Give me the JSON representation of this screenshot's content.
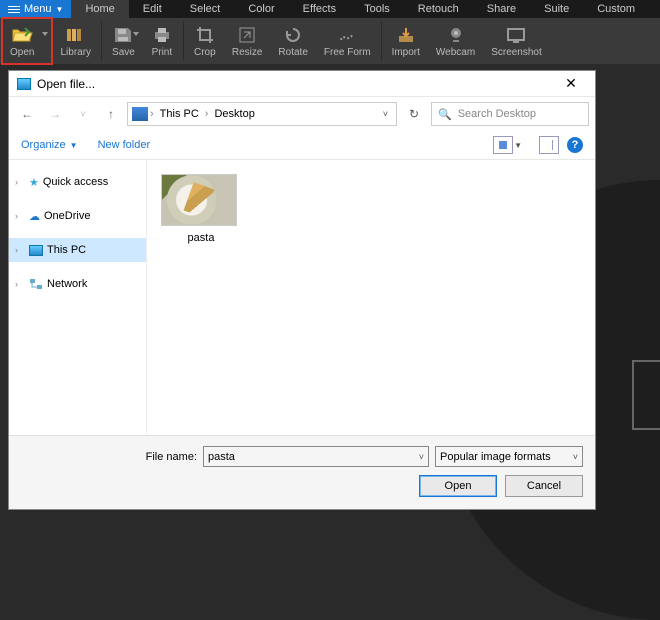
{
  "menu": {
    "label": "Menu"
  },
  "tabs": [
    "Home",
    "Edit",
    "Select",
    "Color",
    "Effects",
    "Tools",
    "Retouch",
    "Share",
    "Suite",
    "Custom"
  ],
  "active_tab_index": 0,
  "ribbon": [
    {
      "label": "Open",
      "highlight": true,
      "dropdown": true
    },
    {
      "label": "Library"
    },
    {
      "label": "Save",
      "dropdown": true
    },
    {
      "label": "Print"
    },
    {
      "label": "Crop"
    },
    {
      "label": "Resize"
    },
    {
      "label": "Rotate"
    },
    {
      "label": "Free Form"
    },
    {
      "label": "Import"
    },
    {
      "label": "Webcam"
    },
    {
      "label": "Screenshot"
    }
  ],
  "dialog": {
    "title": "Open file...",
    "path": {
      "root": "This PC",
      "segments": [
        "Desktop"
      ]
    },
    "search_placeholder": "Search Desktop",
    "organize": "Organize",
    "newfolder": "New folder",
    "tree": [
      {
        "label": "Quick access",
        "icon": "star"
      },
      {
        "label": "OneDrive",
        "icon": "cloud"
      },
      {
        "label": "This PC",
        "icon": "pc",
        "selected": true
      },
      {
        "label": "Network",
        "icon": "net"
      }
    ],
    "files": [
      {
        "name": "pasta"
      }
    ],
    "filename_label": "File name:",
    "filename_value": "pasta",
    "filter": "Popular image formats",
    "open": "Open",
    "cancel": "Cancel"
  }
}
